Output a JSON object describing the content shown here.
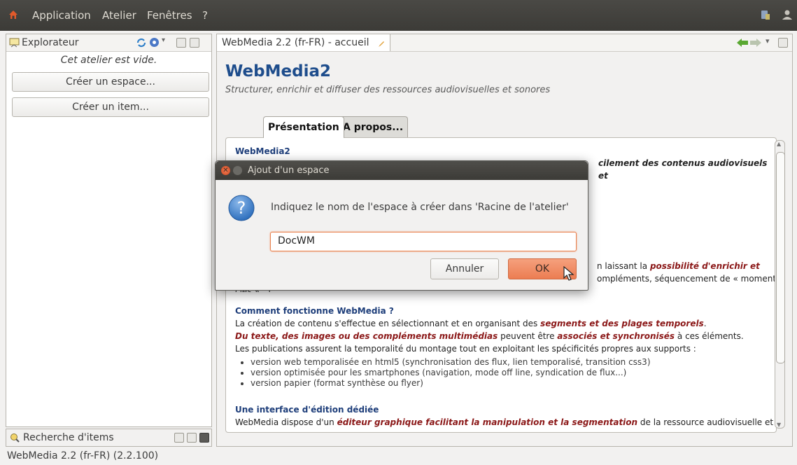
{
  "menubar": {
    "items": [
      "Application",
      "Atelier",
      "Fenêtres",
      "?"
    ]
  },
  "explorer": {
    "title": "Explorateur",
    "empty_text": "Cet atelier est vide.",
    "create_space_button": "Créer un espace...",
    "create_item_button": "Créer un item..."
  },
  "search_panel": {
    "title": "Recherche d'items"
  },
  "editor": {
    "tab_title": "WebMedia 2.2 (fr-FR) - accueil",
    "heading": "WebMedia2",
    "subtitle": "Structurer, enrichir et diffuser des ressources audiovisuelles et sonores",
    "tabs": [
      "Présentation",
      "A propos..."
    ],
    "doc": {
      "section1_title": "WebMedia2",
      "section1_frag_right": "cilement des contenus audiovisuels et",
      "section1_frag_r2": "n laissant la",
      "section1_frag_r2_em": "possibilité d'enrichir et",
      "section1_frag_r3": "ompléments, séquencement de « moments",
      "section1_frag_r4": "clés »...)",
      "section2_title": "Comment fonctionne WebMedia ?",
      "section2_line1_a": "La création de contenu s'effectue en sélectionnant et en organisant des",
      "section2_line1_em": "segments et des plages temporels",
      "section2_line1_b": ".",
      "section2_line2_em1": "Du texte, des images ou des compléments multimédias",
      "section2_line2_a": "peuvent être",
      "section2_line2_em2": "associés et synchronisés",
      "section2_line2_b": "à ces éléments.",
      "section2_line3": "Les publications assurent la temporalité du montage tout en exploitant les spécificités propres aux supports :",
      "bullets": [
        "version web temporalisée en html5 (synchronisation des flux, lien temporalisé, transition css3)",
        "version optimisée pour les smartphones (navigation, mode off line, syndication de flux...)",
        "version papier (format synthèse ou flyer)"
      ],
      "section3_title": "Une interface d'édition dédiée",
      "section3_line1_a": "WebMedia dispose d'un",
      "section3_line1_em": "éditeur graphique facilitant la manipulation et la segmentation",
      "section3_line1_b": "de la ressource audiovisuelle et"
    }
  },
  "dialog": {
    "title": "Ajout d'un espace",
    "message": "Indiquez le nom de l'espace à créer dans 'Racine de l'atelier'",
    "input_value": "DocWM",
    "cancel_label": "Annuler",
    "ok_label": "OK"
  },
  "status_bar": {
    "text": "WebMedia 2.2 (fr-FR) (2.2.100)"
  },
  "colors": {
    "accent_orange": "#f0855a",
    "heading_blue": "#1e4d8c",
    "emphasis_red": "#8b1818"
  }
}
